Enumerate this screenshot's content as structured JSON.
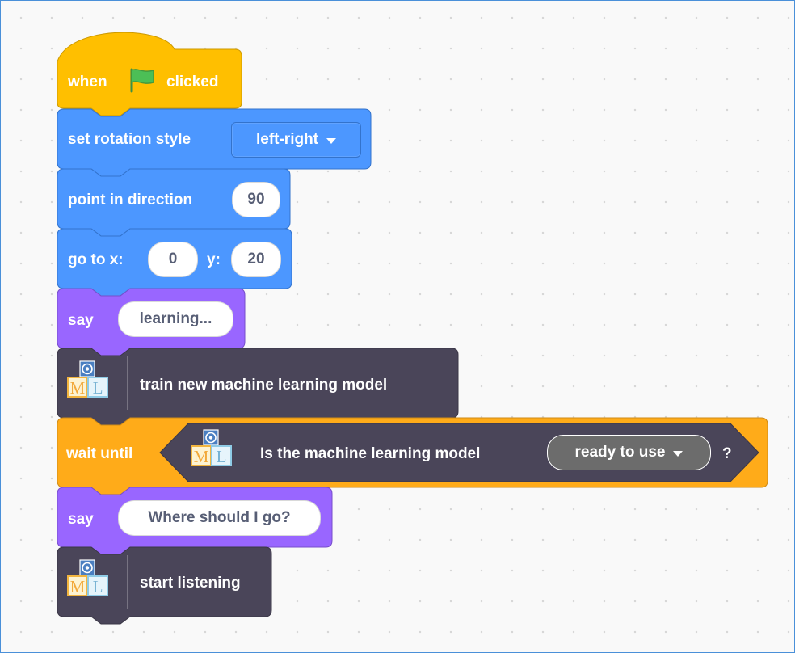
{
  "colors": {
    "events": "#ffbf00",
    "motion": "#4c97ff",
    "looks": "#9966ff",
    "extension": "#4a4559",
    "control": "#ffab19",
    "flag": "#4cbf56"
  },
  "blocks": {
    "when_clicked": {
      "when": "when",
      "clicked": "clicked",
      "icon": "green-flag-icon"
    },
    "rotation": {
      "label": "set rotation style",
      "value": "left-right"
    },
    "point": {
      "label": "point in direction",
      "value": "90"
    },
    "goto": {
      "label_x": "go to x:",
      "x": "0",
      "label_y": "y:",
      "y": "20"
    },
    "say1": {
      "label": "say",
      "value": "learning..."
    },
    "train": {
      "label": "train new machine learning model",
      "icon": "ml-blocks-icon"
    },
    "wait": {
      "label": "wait until",
      "question": "Is the machine learning model",
      "option": "ready to use",
      "suffix": "?"
    },
    "say2": {
      "label": "say",
      "value": "Where should I go?"
    },
    "listen": {
      "label": "start listening",
      "icon": "ml-blocks-icon"
    }
  }
}
